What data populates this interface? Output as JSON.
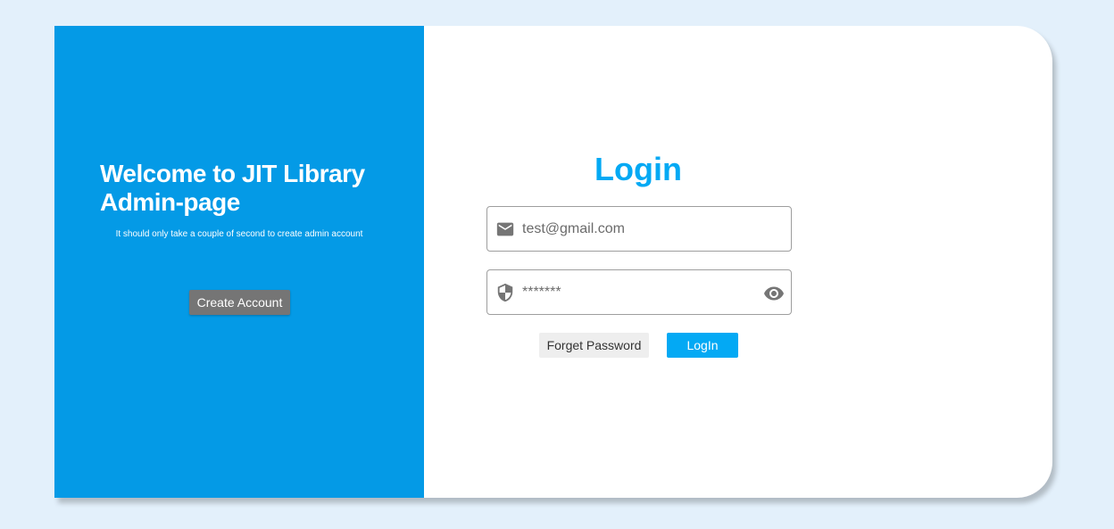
{
  "welcome": {
    "title": "Welcome to JIT Library Admin-page",
    "subtitle": "It should only take a couple of second to create admin account",
    "create_account_label": "Create Account"
  },
  "login": {
    "title": "Login",
    "email_placeholder": "test@gmail.com",
    "password_value": "*******",
    "forget_password_label": "Forget Password",
    "login_button_label": "LogIn"
  },
  "icons": {
    "email": "mail-icon",
    "password": "shield-icon",
    "visibility": "eye-icon"
  },
  "colors": {
    "page_background": "#e3f0fb",
    "left_panel": "#049ae6",
    "accent": "#03a9f4",
    "create_button": "#757575",
    "forget_button": "#eeeeee"
  }
}
